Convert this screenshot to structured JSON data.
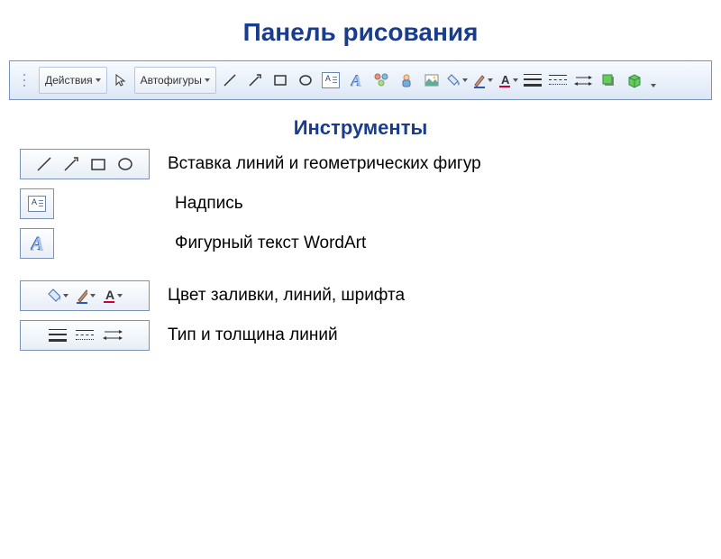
{
  "title": "Панель рисования",
  "subtitle": "Инструменты",
  "toolbar": {
    "actions_label": "Действия",
    "autoshapes_label": "Автофигуры"
  },
  "rows": {
    "shapes_desc": "Вставка линий и геометрических фигур",
    "textbox_desc": "Надпись",
    "wordart_desc": "Фигурный текст WordArt",
    "colors_desc": "Цвет заливки, линий, шрифта",
    "lines_desc": "Тип и толщина линий"
  }
}
